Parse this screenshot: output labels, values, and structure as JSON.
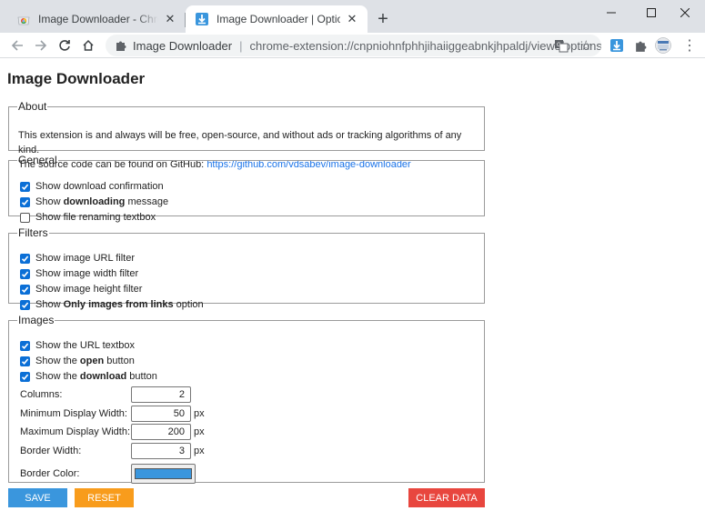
{
  "browser": {
    "tabs": [
      {
        "title": "Image Downloader - Chrome Web Store",
        "active": false
      },
      {
        "title": "Image Downloader | Options",
        "active": true
      }
    ],
    "omnibox": {
      "site": "Image Downloader",
      "divider": "|",
      "url": "chrome-extension://cnpniohnfphhjihaiiggeabnkjhpaldj/views/options.html"
    }
  },
  "page": {
    "title": "Image Downloader",
    "about": {
      "legend": "About",
      "line1": "This extension is and always will be free, open-source, and without ads or tracking algorithms of any kind.",
      "line2_prefix": "The source code can be found on GitHub: ",
      "github_link": "https://github.com/vdsabev/image-downloader"
    },
    "general": {
      "legend": "General",
      "options": [
        {
          "pre": "Show download confirmation",
          "bold": "",
          "post": "",
          "checked": true
        },
        {
          "pre": "Show ",
          "bold": "downloading",
          "post": " message",
          "checked": true
        },
        {
          "pre": "Show file renaming textbox",
          "bold": "",
          "post": "",
          "checked": false
        }
      ]
    },
    "filters": {
      "legend": "Filters",
      "options": [
        {
          "pre": "Show image URL filter",
          "bold": "",
          "post": "",
          "checked": true
        },
        {
          "pre": "Show image width filter",
          "bold": "",
          "post": "",
          "checked": true
        },
        {
          "pre": "Show image height filter",
          "bold": "",
          "post": "",
          "checked": true
        },
        {
          "pre": "Show ",
          "bold": "Only images from links",
          "post": " option",
          "checked": true
        }
      ]
    },
    "images": {
      "legend": "Images",
      "options": [
        {
          "pre": "Show the URL textbox",
          "bold": "",
          "post": "",
          "checked": true
        },
        {
          "pre": "Show the ",
          "bold": "open",
          "post": " button",
          "checked": true
        },
        {
          "pre": "Show the ",
          "bold": "download",
          "post": " button",
          "checked": true
        }
      ],
      "fields": {
        "columns": {
          "label": "Columns:",
          "value": "2",
          "unit": ""
        },
        "min_width": {
          "label": "Minimum Display Width:",
          "value": "50",
          "unit": "px"
        },
        "max_width": {
          "label": "Maximum Display Width:",
          "value": "200",
          "unit": "px"
        },
        "border_width": {
          "label": "Border Width:",
          "value": "3",
          "unit": "px"
        },
        "border_color": {
          "label": "Border Color:",
          "value": "#3a96dd"
        }
      }
    },
    "buttons": {
      "save": "SAVE",
      "reset": "RESET",
      "clear": "CLEAR DATA"
    }
  },
  "colors": {
    "save": "#3a96dd",
    "reset": "#f89c1c",
    "clear": "#e8463e",
    "checkbox": "#0b6fd6",
    "link": "#1a73e8"
  },
  "icons": {
    "tab1_favicon": "chrome-web-store-icon",
    "tab2_favicon": "download-arrow-icon",
    "omnibox": "puzzle-icon",
    "toolbar": [
      "download-arrow-icon",
      "puzzle-icon",
      "profile-icon",
      "menu-dots-icon"
    ]
  }
}
